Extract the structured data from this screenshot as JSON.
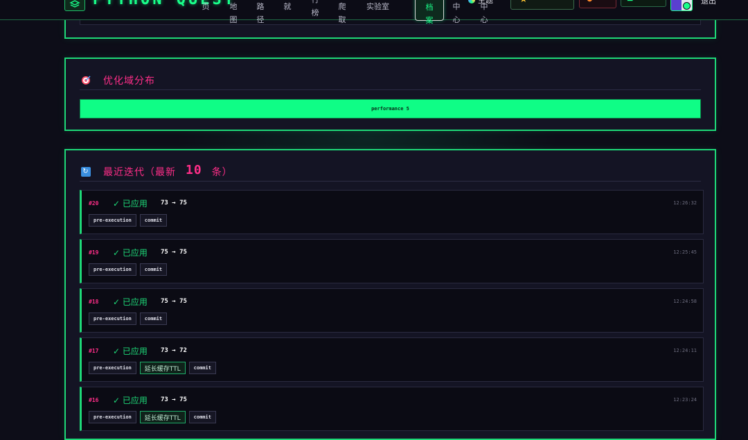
{
  "nav": {
    "logo_text": "PYTHON QUEST",
    "items": [
      {
        "label": "页"
      },
      {
        "label": "地图"
      },
      {
        "label": "路径"
      },
      {
        "label": "就"
      },
      {
        "label": "行榜"
      },
      {
        "label": "爬取"
      },
      {
        "label": "实验室"
      },
      {
        "label": "档案"
      },
      {
        "label": "中心"
      },
      {
        "label": "中心"
      }
    ],
    "theme_label": "主题",
    "logout_label": "退出"
  },
  "domain_panel": {
    "title": "优化域分布",
    "bar_label": "performance 5",
    "bar_fraction": 1.0
  },
  "recent_panel": {
    "title_prefix": "最近迭代（最新",
    "count": "10",
    "title_suffix": "条）"
  },
  "iterations": [
    {
      "id": "#20",
      "status": "✓ 已应用",
      "score": "73 → 75",
      "time": "12:26:32",
      "tags": [
        "pre-execution",
        "commit"
      ]
    },
    {
      "id": "#19",
      "status": "✓ 已应用",
      "score": "75 → 75",
      "time": "12:25:45",
      "tags": [
        "pre-execution",
        "commit"
      ]
    },
    {
      "id": "#18",
      "status": "✓ 已应用",
      "score": "75 → 75",
      "time": "12:24:58",
      "tags": [
        "pre-execution",
        "commit"
      ]
    },
    {
      "id": "#17",
      "status": "✓ 已应用",
      "score": "73 → 72",
      "time": "12:24:11",
      "tags": [
        "pre-execution",
        "延长缓存TTL",
        "commit"
      ]
    },
    {
      "id": "#16",
      "status": "✓ 已应用",
      "score": "73 → 75",
      "time": "12:23:24",
      "tags": [
        "pre-execution",
        "延长缓存TTL",
        "commit"
      ]
    }
  ],
  "colors": {
    "accent_green": "#1ed978",
    "accent_pink": "#ff2e88",
    "background": "#0d0d18"
  }
}
